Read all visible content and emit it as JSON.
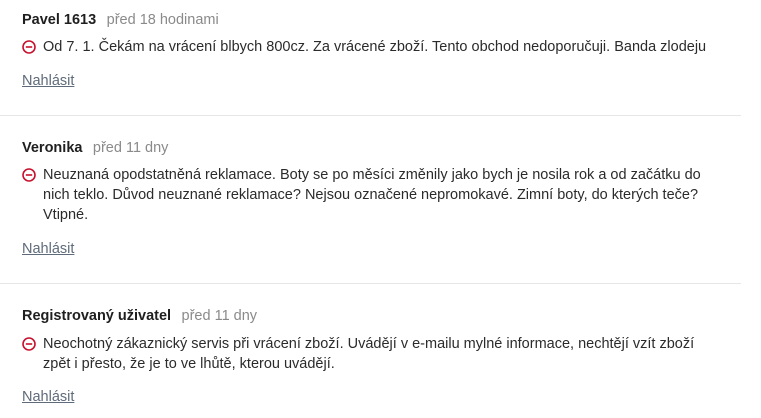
{
  "reviews": [
    {
      "author": "Pavel 1613",
      "time": "před 18 hodinami",
      "cons": "Od 7. 1. Čekám na vrácení blbych 800cz. Za vrácené zboží. Tento obchod nedoporučuji. Banda zlodeju",
      "report": "Nahlásit"
    },
    {
      "author": "Veronika",
      "time": "před 11 dny",
      "cons": "Neuznaná opodstatněná reklamace. Boty se po měsíci změnily jako bych je nosila rok a od začátku do nich teklo. Důvod neuznané reklamace? Nejsou označené nepromokavé. Zimní boty, do kterých teče? Vtipné.",
      "report": "Nahlásit"
    },
    {
      "author": "Registrovaný uživatel",
      "time": "před 11 dny",
      "cons": "Neochotný zákaznický servis při vrácení zboží. Uvádějí v e-mailu mylné informace, nechtějí vzít zboží zpět i přesto, že je to ve lhůtě, kterou uvádějí.",
      "report": "Nahlásit"
    }
  ],
  "colors": {
    "negative": "#c8102e",
    "link": "#5f6b7a",
    "muted": "#8a8a8a",
    "divider": "#e6e6e6"
  },
  "icons": {
    "con": "minus-circle-icon"
  }
}
